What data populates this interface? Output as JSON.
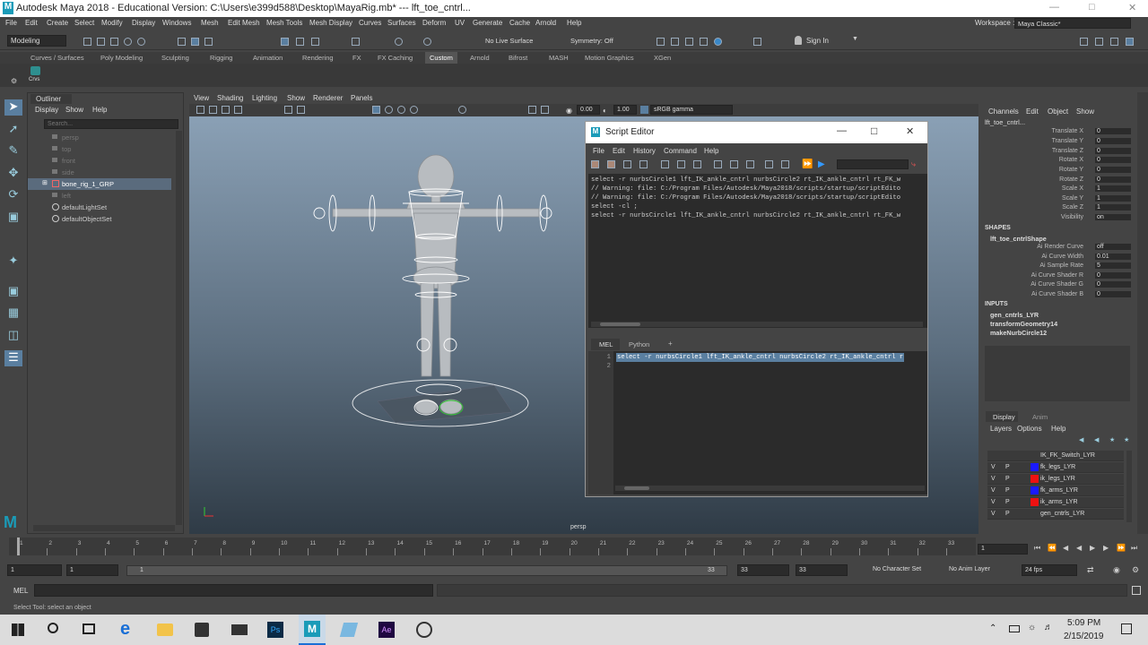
{
  "window": {
    "title": "Autodesk Maya 2018 - Educational Version: C:\\Users\\e399d588\\Desktop\\MayaRig.mb*  ---  lft_toe_cntrl...",
    "workspace_label": "Workspace :",
    "workspace_value": "Maya Classic*"
  },
  "menubar": [
    "File",
    "Edit",
    "Create",
    "Select",
    "Modify",
    "Display",
    "Windows",
    "Mesh",
    "Edit Mesh",
    "Mesh Tools",
    "Mesh Display",
    "Curves",
    "Surfaces",
    "Deform",
    "UV",
    "Generate",
    "Cache",
    "Arnold",
    "Help"
  ],
  "statusline": {
    "mode": "Modeling",
    "live_surface": "No Live Surface",
    "symmetry": "Symmetry: Off",
    "sign_in": "Sign In"
  },
  "shelf": {
    "tabs": [
      "Curves / Surfaces",
      "Poly Modeling",
      "Sculpting",
      "Rigging",
      "Animation",
      "Rendering",
      "FX",
      "FX Caching",
      "Custom",
      "Arnold",
      "Bifrost",
      "MASH",
      "Motion Graphics",
      "XGen"
    ],
    "active_tab": "Custom",
    "button_label": "Crvs"
  },
  "outliner": {
    "title": "Outliner",
    "menu": [
      "Display",
      "Show",
      "Help"
    ],
    "search_placeholder": "Search...",
    "items": [
      {
        "label": "persp",
        "dim": true
      },
      {
        "label": "top",
        "dim": true
      },
      {
        "label": "front",
        "dim": true
      },
      {
        "label": "side",
        "dim": true
      },
      {
        "label": "bone_rig_1_GRP",
        "dim": false
      },
      {
        "label": "left",
        "dim": true
      },
      {
        "label": "defaultLightSet",
        "dim": false
      },
      {
        "label": "defaultObjectSet",
        "dim": false
      }
    ]
  },
  "viewport": {
    "menu": [
      "View",
      "Shading",
      "Lighting",
      "Show",
      "Renderer",
      "Panels"
    ],
    "value_a": "0.00",
    "value_b": "1.00",
    "color_space": "sRGB gamma",
    "camera_label": "persp"
  },
  "script_editor": {
    "title": "Script Editor",
    "menu": [
      "File",
      "Edit",
      "History",
      "Command",
      "Help"
    ],
    "history": [
      "select -r nurbsCircle1 lft_IK_ankle_cntrl nurbsCircle2 rt_IK_ankle_cntrl rt_FK_w",
      "// Warning: file: C:/Program Files/Autodesk/Maya2018/scripts/startup/scriptEdito",
      "// Warning: file: C:/Program Files/Autodesk/Maya2018/scripts/startup/scriptEdito",
      "select -cl  ;",
      "select -r nurbsCircle1 lft_IK_ankle_cntrl nurbsCircle2 rt_IK_ankle_cntrl rt_FK_w"
    ],
    "tabs": [
      "MEL",
      "Python",
      "+"
    ],
    "line_numbers": [
      "1",
      "2"
    ],
    "input_line": "select -r nurbsCircle1 lft_IK_ankle_cntrl nurbsCircle2 rt_IK_ankle_cntrl r"
  },
  "channel_box": {
    "menu": [
      "Channels",
      "Edit",
      "Object",
      "Show"
    ],
    "object_name": "lft_toe_cntrl...",
    "channels": [
      {
        "name": "Translate X",
        "value": "0"
      },
      {
        "name": "Translate Y",
        "value": "0"
      },
      {
        "name": "Translate Z",
        "value": "0"
      },
      {
        "name": "Rotate X",
        "value": "0"
      },
      {
        "name": "Rotate Y",
        "value": "0"
      },
      {
        "name": "Rotate Z",
        "value": "0"
      },
      {
        "name": "Scale X",
        "value": "1"
      },
      {
        "name": "Scale Y",
        "value": "1"
      },
      {
        "name": "Scale Z",
        "value": "1"
      },
      {
        "name": "Visibility",
        "value": "on"
      }
    ],
    "shapes_header": "SHAPES",
    "shape_name": "lft_toe_cntrlShape",
    "shape_attrs": [
      {
        "name": "Ai Render Curve",
        "value": "off"
      },
      {
        "name": "Ai Curve Width",
        "value": "0.01"
      },
      {
        "name": "Ai Sample Rate",
        "value": "5"
      },
      {
        "name": "Ai Curve Shader R",
        "value": "0"
      },
      {
        "name": "Ai Curve Shader G",
        "value": "0"
      },
      {
        "name": "Ai Curve Shader B",
        "value": "0"
      }
    ],
    "inputs_header": "INPUTS",
    "inputs": [
      "gen_cntrls_LYR",
      "transformGeometry14",
      "makeNurbCircle12"
    ]
  },
  "layer_editor": {
    "tabs": [
      "Display",
      "Anim"
    ],
    "menu": [
      "Layers",
      "Options",
      "Help"
    ],
    "layers": [
      {
        "v": "",
        "p": "",
        "color": "",
        "name": "IK_FK_Switch_LYR"
      },
      {
        "v": "V",
        "p": "P",
        "color": "#1a1aff",
        "name": "fk_legs_LYR"
      },
      {
        "v": "V",
        "p": "P",
        "color": "#ee1111",
        "name": "ik_legs_LYR"
      },
      {
        "v": "V",
        "p": "P",
        "color": "#1a1aff",
        "name": "fk_arms_LYR"
      },
      {
        "v": "V",
        "p": "P",
        "color": "#ee1111",
        "name": "ik_arms_LYR"
      },
      {
        "v": "V",
        "p": "P",
        "color": "",
        "name": "gen_cntrls_LYR"
      }
    ]
  },
  "time_slider": {
    "ticks": [
      "1",
      "2",
      "3",
      "4",
      "5",
      "6",
      "7",
      "8",
      "9",
      "10",
      "11",
      "12",
      "13",
      "14",
      "15",
      "16",
      "17",
      "18",
      "19",
      "20",
      "21",
      "22",
      "23",
      "24",
      "25",
      "26",
      "27",
      "28",
      "29",
      "30",
      "31",
      "32",
      "33"
    ],
    "current_frame": "1"
  },
  "range_slider": {
    "start": "1",
    "anim_start": "1",
    "range_left": "1",
    "range_right": "33",
    "anim_end": "33",
    "end": "33",
    "character_set": "No Character Set",
    "anim_layer": "No Anim Layer",
    "fps": "24 fps"
  },
  "command_line": {
    "lang": "MEL"
  },
  "help_line": "Select Tool: select an object",
  "taskbar": {
    "time": "5:09 PM",
    "date": "2/15/2019"
  }
}
